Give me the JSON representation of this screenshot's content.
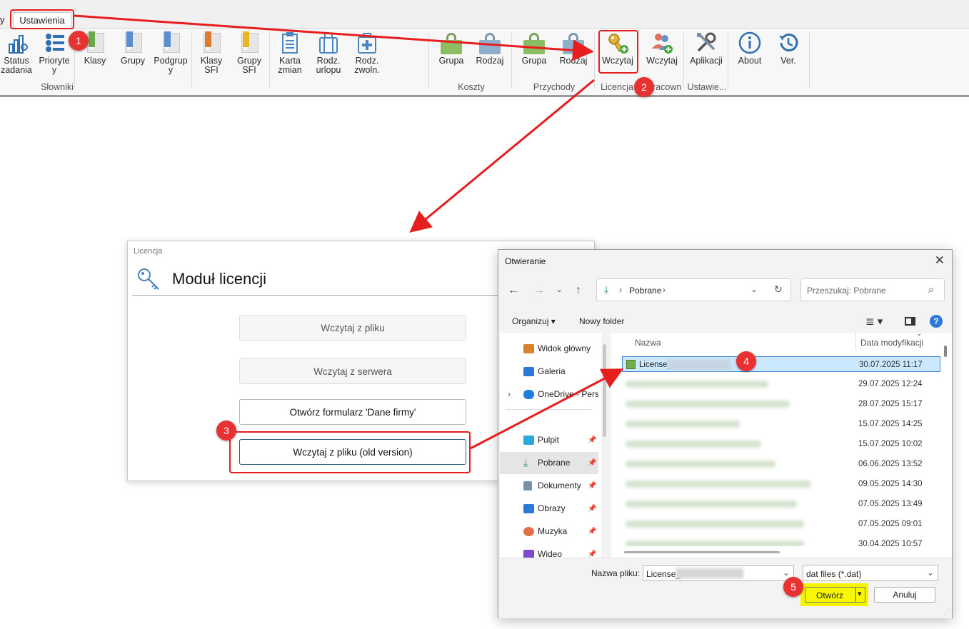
{
  "tabbar": {
    "partial_tab": "y",
    "active_tab": "Ustawienia"
  },
  "ribbon": {
    "slowniki": {
      "label": "Słowniki",
      "buttons": [
        {
          "line1": "Status",
          "line2": "zadania"
        },
        {
          "line1": "Prioryte",
          "line2": "y"
        },
        {
          "line1": "Klasy",
          "line2": ""
        },
        {
          "line1": "Grupy",
          "line2": ""
        },
        {
          "line1": "Podgrup",
          "line2": "y"
        },
        {
          "line1": "Klasy",
          "line2": "SFI"
        },
        {
          "line1": "Grupy",
          "line2": "SFI"
        },
        {
          "line1": "Karta",
          "line2": "zmian"
        },
        {
          "line1": "Rodz.",
          "line2": "urlopu"
        },
        {
          "line1": "Rodz.",
          "line2": "zwoln."
        }
      ]
    },
    "koszty": {
      "label": "Koszty",
      "buttons": [
        "Grupa",
        "Rodzaj"
      ]
    },
    "przychody": {
      "label": "Przychody",
      "buttons": [
        "Grupa",
        "Rodzaj"
      ]
    },
    "licencja": {
      "label": "Licencja",
      "button": "Wczytaj"
    },
    "pracownicy": {
      "label": "Pracown",
      "button": "Wczytaj"
    },
    "ustawienia": {
      "label": "Ustawie...",
      "button": "Aplikacji"
    },
    "about": {
      "label": "About"
    },
    "ver": {
      "label": "Ver."
    }
  },
  "license_dialog": {
    "window_title": "Licencja",
    "heading": "Moduł licencji",
    "buttons": [
      "Wczytaj z pliku",
      "Wczytaj  z serwera",
      "Otwórz formularz 'Dane firmy'",
      "Wczytaj z pliku (old version)"
    ]
  },
  "file_dialog": {
    "title": "Otwieranie",
    "address": {
      "location": "Pobrane"
    },
    "search_placeholder": "Przeszukaj: Pobrane",
    "toolbar": {
      "organize": "Organizuj",
      "new_folder": "Nowy folder"
    },
    "nav_items": [
      {
        "label": "Widok główny",
        "icon": "home-icon",
        "pinned": false,
        "color": "#d8822b"
      },
      {
        "label": "Galeria",
        "icon": "gallery-icon",
        "pinned": false,
        "color": "#2b78d8"
      },
      {
        "label": "OneDrive - Pers",
        "icon": "cloud-icon",
        "pinned": false,
        "color": "#1f7fe0"
      },
      {
        "label": "Pulpit",
        "icon": "desktop-icon",
        "pinned": true,
        "color": "#2aa9e0"
      },
      {
        "label": "Pobrane",
        "icon": "download-icon",
        "pinned": true,
        "color": "#2a9a5a"
      },
      {
        "label": "Dokumenty",
        "icon": "document-icon",
        "pinned": true,
        "color": "#7890a8"
      },
      {
        "label": "Obrazy",
        "icon": "pictures-icon",
        "pinned": true,
        "color": "#2b78d8"
      },
      {
        "label": "Muzyka",
        "icon": "music-icon",
        "pinned": true,
        "color": "#e0704a"
      },
      {
        "label": "Wideo",
        "icon": "video-icon",
        "pinned": true,
        "color": "#7a4ad0"
      }
    ],
    "columns": {
      "name": "Nazwa",
      "modified": "Data modyfikacji"
    },
    "files": [
      {
        "name": "License_",
        "date": "30.07.2025 11:17",
        "selected": true
      },
      {
        "name": "",
        "date": "29.07.2025 12:24",
        "selected": false
      },
      {
        "name": "",
        "date": "28.07.2025 15:17",
        "selected": false
      },
      {
        "name": "",
        "date": "15.07.2025 14:25",
        "selected": false
      },
      {
        "name": "",
        "date": "15.07.2025 10:02",
        "selected": false
      },
      {
        "name": "",
        "date": "06.06.2025 13:52",
        "selected": false
      },
      {
        "name": "",
        "date": "09.05.2025 14:30",
        "selected": false
      },
      {
        "name": "",
        "date": "07.05.2025 13:49",
        "selected": false
      },
      {
        "name": "",
        "date": "07.05.2025 09:01",
        "selected": false
      },
      {
        "name": "",
        "date": "30.04.2025 10:57",
        "selected": false
      }
    ],
    "filename_label": "Nazwa pliku:",
    "filename_value": "License_",
    "filter": "dat files (*.dat)",
    "open_button": "Otwórz",
    "cancel_button": "Anuluj"
  },
  "callouts": [
    "1",
    "2",
    "3",
    "4",
    "5"
  ],
  "colors": {
    "annotation_red": "#e61e1e",
    "highlight_yellow": "#f5f500",
    "selected_row": "#cce8ff"
  }
}
